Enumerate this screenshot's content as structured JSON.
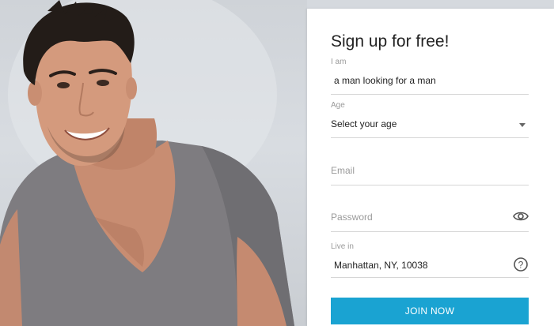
{
  "signup": {
    "title": "Sign up for free!",
    "iam": {
      "label": "I am",
      "value": "a man looking for a man"
    },
    "age": {
      "label": "Age",
      "value": "Select your age"
    },
    "email": {
      "placeholder": "Email"
    },
    "password": {
      "placeholder": "Password",
      "icon": "eye-icon"
    },
    "live_in": {
      "label": "Live in",
      "value": "Manhattan, NY, 10038",
      "icon": "help-icon"
    },
    "join_label": "JOIN NOW"
  },
  "colors": {
    "accent": "#1aa3d2",
    "background": "#d5d9de",
    "card": "#ffffff"
  }
}
